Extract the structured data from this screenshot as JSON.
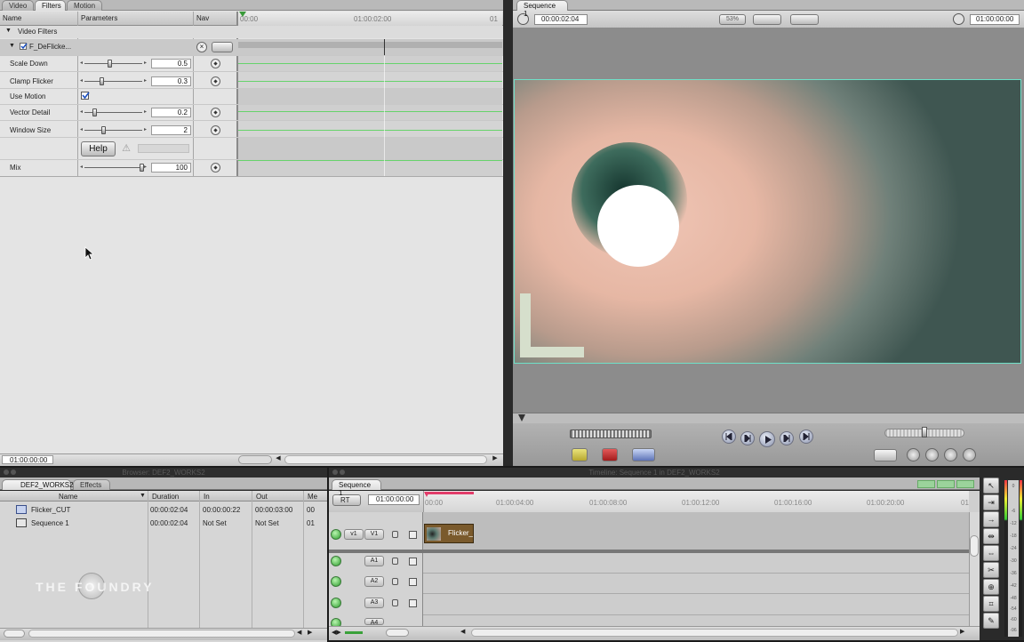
{
  "viewer": {
    "tabs": [
      "Video",
      "Filters",
      "Motion"
    ],
    "columns": {
      "name": "Name",
      "parameters": "Parameters",
      "nav": "Nav"
    },
    "ruler": {
      "start": "00:00",
      "mid": "01:00:02:00",
      "end": "01"
    },
    "section": "Video Filters",
    "filter_name": "F_DeFlicke...",
    "params": [
      {
        "label": "Scale Down",
        "value": "0.5"
      },
      {
        "label": "Clamp Flicker",
        "value": "0.3"
      },
      {
        "label": "Use Motion",
        "value": ""
      },
      {
        "label": "Vector Detail",
        "value": "0.2"
      },
      {
        "label": "Window Size",
        "value": "2"
      },
      {
        "label": "",
        "value": ""
      },
      {
        "label": "Mix",
        "value": "100"
      }
    ],
    "help_label": "Help",
    "timecode": "01:00:00:00"
  },
  "canvas": {
    "tab": "Sequence 1",
    "timecode_left": "00:00:02:04",
    "zoom": "53%",
    "timecode_right": "01:00:00:00"
  },
  "browser": {
    "title": "Browser: DEF2_WORKS2",
    "tabs": [
      "DEF2_WORKS2",
      "Effects"
    ],
    "columns": [
      "Name",
      "Duration",
      "In",
      "Out",
      "Me"
    ],
    "rows": [
      {
        "name": "Flicker_CUT",
        "duration": "00:00:02:04",
        "in": "00:00:00:22",
        "out": "00:00:03:00",
        "me": "00"
      },
      {
        "name": "Sequence 1",
        "duration": "00:00:02:04",
        "in": "Not Set",
        "out": "Not Set",
        "me": "01"
      }
    ],
    "watermark": "THE  FOUNDRY"
  },
  "timeline": {
    "title": "Timeline: Sequence 1 in DEF2_WORKS2",
    "tab": "Sequence 1",
    "rt": "RT",
    "timecode": "01:00:00:00",
    "ruler": [
      "00:00",
      "01:00:04:00",
      "01:00:08:00",
      "01:00:12:00",
      "01:00:16:00",
      "01:00:20:00",
      "01"
    ],
    "src_v": "v1",
    "tracks": [
      "V1",
      "A1",
      "A2",
      "A3",
      "A4"
    ],
    "clip": "Flicker_"
  },
  "audio_meter": [
    "0",
    "-6",
    "-12",
    "-18",
    "-24",
    "-30",
    "-36",
    "-42",
    "-48",
    "-54",
    "-60",
    "-96"
  ],
  "colors": {
    "selection": "#6fe0c8",
    "clip": "#7a5a2c",
    "playhead": "#e23c6a"
  }
}
